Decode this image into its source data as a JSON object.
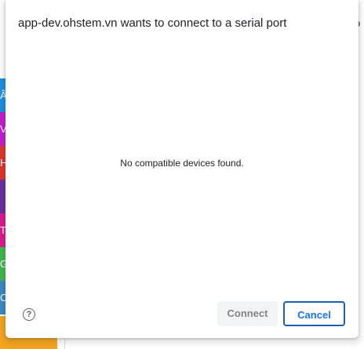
{
  "background": {
    "right_text": "o",
    "tabs": [
      {
        "letter": "Â",
        "color": "#1a8fe3"
      },
      {
        "letter": "V",
        "color": "#c41bd1"
      },
      {
        "letter": "H",
        "color": "#e0332b"
      },
      {
        "letter": "",
        "color": "#6a2ea2"
      },
      {
        "letter": "T",
        "color": "#e0188f"
      },
      {
        "letter": "G",
        "color": "#3eb84a"
      },
      {
        "letter": "C",
        "color": "#3a88c8"
      }
    ]
  },
  "dialog": {
    "title": "app-dev.ohstem.vn wants to connect to a serial port",
    "empty_message": "No compatible devices found.",
    "help_icon": "?",
    "connect_label": "Connect",
    "cancel_label": "Cancel"
  }
}
